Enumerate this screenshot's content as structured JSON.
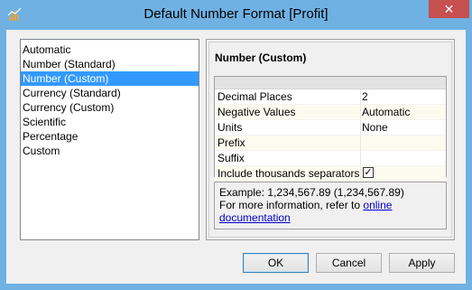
{
  "window": {
    "title": "Default Number Format [Profit]",
    "close_label": "✕"
  },
  "format_list": {
    "items": [
      {
        "label": "Automatic",
        "selected": false
      },
      {
        "label": "Number (Standard)",
        "selected": false
      },
      {
        "label": "Number (Custom)",
        "selected": true
      },
      {
        "label": "Currency (Standard)",
        "selected": false
      },
      {
        "label": "Currency (Custom)",
        "selected": false
      },
      {
        "label": "Scientific",
        "selected": false
      },
      {
        "label": "Percentage",
        "selected": false
      },
      {
        "label": "Custom",
        "selected": false
      }
    ]
  },
  "details": {
    "title": "Number (Custom)",
    "properties": [
      {
        "name": "Decimal Places",
        "value": "2"
      },
      {
        "name": "Negative Values",
        "value": "Automatic"
      },
      {
        "name": "Units",
        "value": "None"
      },
      {
        "name": "Prefix",
        "value": ""
      },
      {
        "name": "Suffix",
        "value": ""
      },
      {
        "name": "Include thousands separators",
        "checked": true
      }
    ],
    "example_line": "Example: 1,234,567.89   (1,234,567.89)",
    "info_prefix": "For more information, refer to ",
    "link_part1": "online",
    "link_part2": "documentation"
  },
  "buttons": {
    "ok": "OK",
    "cancel": "Cancel",
    "apply": "Apply"
  },
  "icons": {
    "app": "tableau-chart-icon",
    "close": "close-icon",
    "checkbox": "checkmark-icon"
  }
}
